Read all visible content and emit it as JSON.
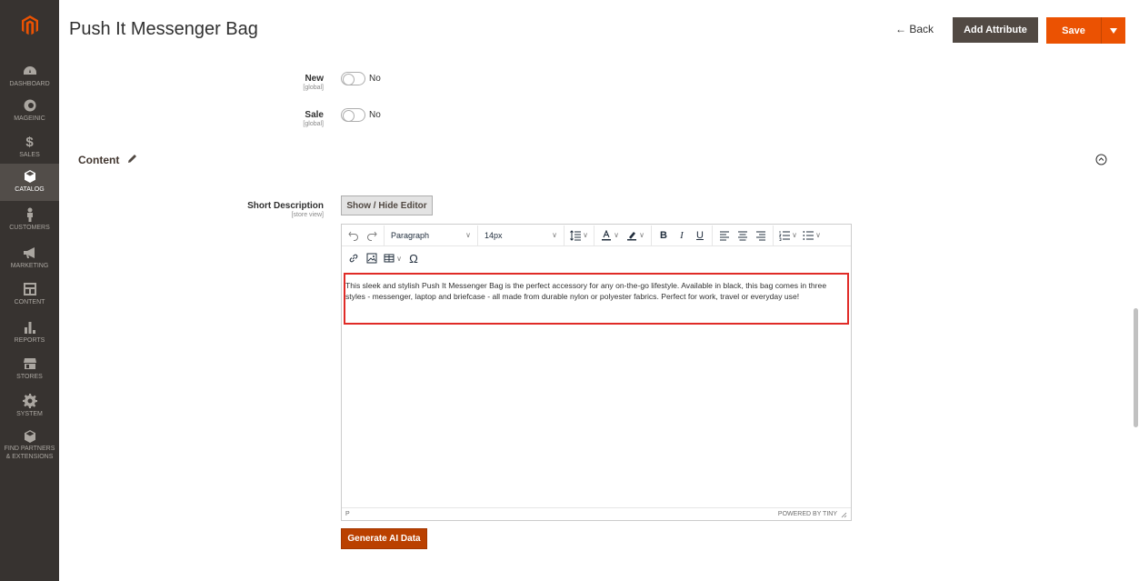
{
  "header": {
    "title": "Push It Messenger Bag",
    "back_label": "← Back",
    "add_attribute_label": "Add Attribute",
    "save_label": "Save"
  },
  "sidebar": {
    "items": [
      {
        "label": "DASHBOARD",
        "icon": "dashboard-icon",
        "active": false
      },
      {
        "label": "MAGEINIC",
        "icon": "mageinic-icon",
        "active": false
      },
      {
        "label": "SALES",
        "icon": "dollar-icon",
        "active": false
      },
      {
        "label": "CATALOG",
        "icon": "cube-icon",
        "active": true
      },
      {
        "label": "CUSTOMERS",
        "icon": "person-icon",
        "active": false
      },
      {
        "label": "MARKETING",
        "icon": "megaphone-icon",
        "active": false
      },
      {
        "label": "CONTENT",
        "icon": "layout-icon",
        "active": false
      },
      {
        "label": "REPORTS",
        "icon": "bar-chart-icon",
        "active": false
      },
      {
        "label": "STORES",
        "icon": "store-icon",
        "active": false
      },
      {
        "label": "SYSTEM",
        "icon": "gear-icon",
        "active": false
      },
      {
        "label": "FIND PARTNERS",
        "label2": "& EXTENSIONS",
        "icon": "partners-icon",
        "active": false
      }
    ]
  },
  "fields": {
    "new": {
      "label": "New",
      "scope": "[global]",
      "value": "No"
    },
    "sale": {
      "label": "Sale",
      "scope": "[global]",
      "value": "No"
    }
  },
  "content_section": {
    "title": "Content",
    "short_description": {
      "label": "Short Description",
      "scope": "[store view]",
      "toggle_editor_label": "Show / Hide Editor",
      "format_select": "Paragraph",
      "size_select": "14px",
      "text": "This sleek and stylish Push It Messenger Bag is the perfect accessory for any on-the-go lifestyle. Available in black, this bag comes in three styles - messenger, laptop and briefcase - all made from durable nylon or polyester fabrics. Perfect for work, travel or everyday use!",
      "status_path": "P",
      "powered_by": "POWERED BY TINY"
    },
    "generate_ai_label": "Generate AI Data"
  },
  "colors": {
    "sidebar_bg": "#373330",
    "save_orange": "#eb5202",
    "highlight_red": "#e02b27",
    "generate_btn": "#ba4000"
  }
}
